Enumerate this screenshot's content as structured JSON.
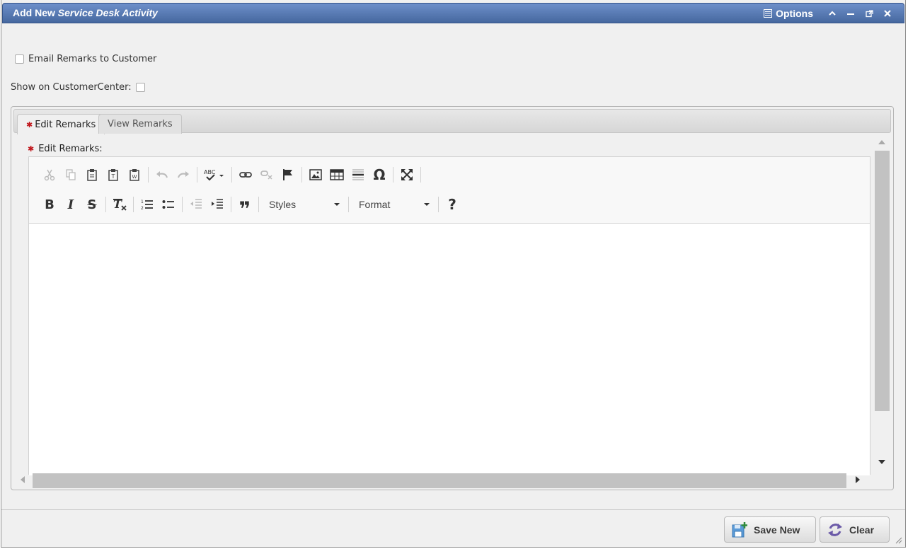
{
  "window": {
    "title_prefix": "Add New",
    "title_entity": "Service Desk Activity",
    "options_label": "Options"
  },
  "form": {
    "email_remarks_label": "Email Remarks to Customer",
    "show_on_customer_center_label": "Show on CustomerCenter:",
    "email_remarks_checked": false,
    "show_on_customer_center_checked": false
  },
  "tabs": [
    {
      "label": "Edit Remarks",
      "required": true,
      "active": true
    },
    {
      "label": "View Remarks",
      "required": false,
      "active": false
    }
  ],
  "editor": {
    "label": "Edit Remarks:",
    "styles_label": "Styles",
    "format_label": "Format",
    "content": ""
  },
  "footer": {
    "save_new_label": "Save New",
    "clear_label": "Clear"
  },
  "colors": {
    "titlebar": "#46689f",
    "required": "#c0161b",
    "save_icon": "#4a90d9",
    "clear_icon": "#6b5aa8"
  }
}
